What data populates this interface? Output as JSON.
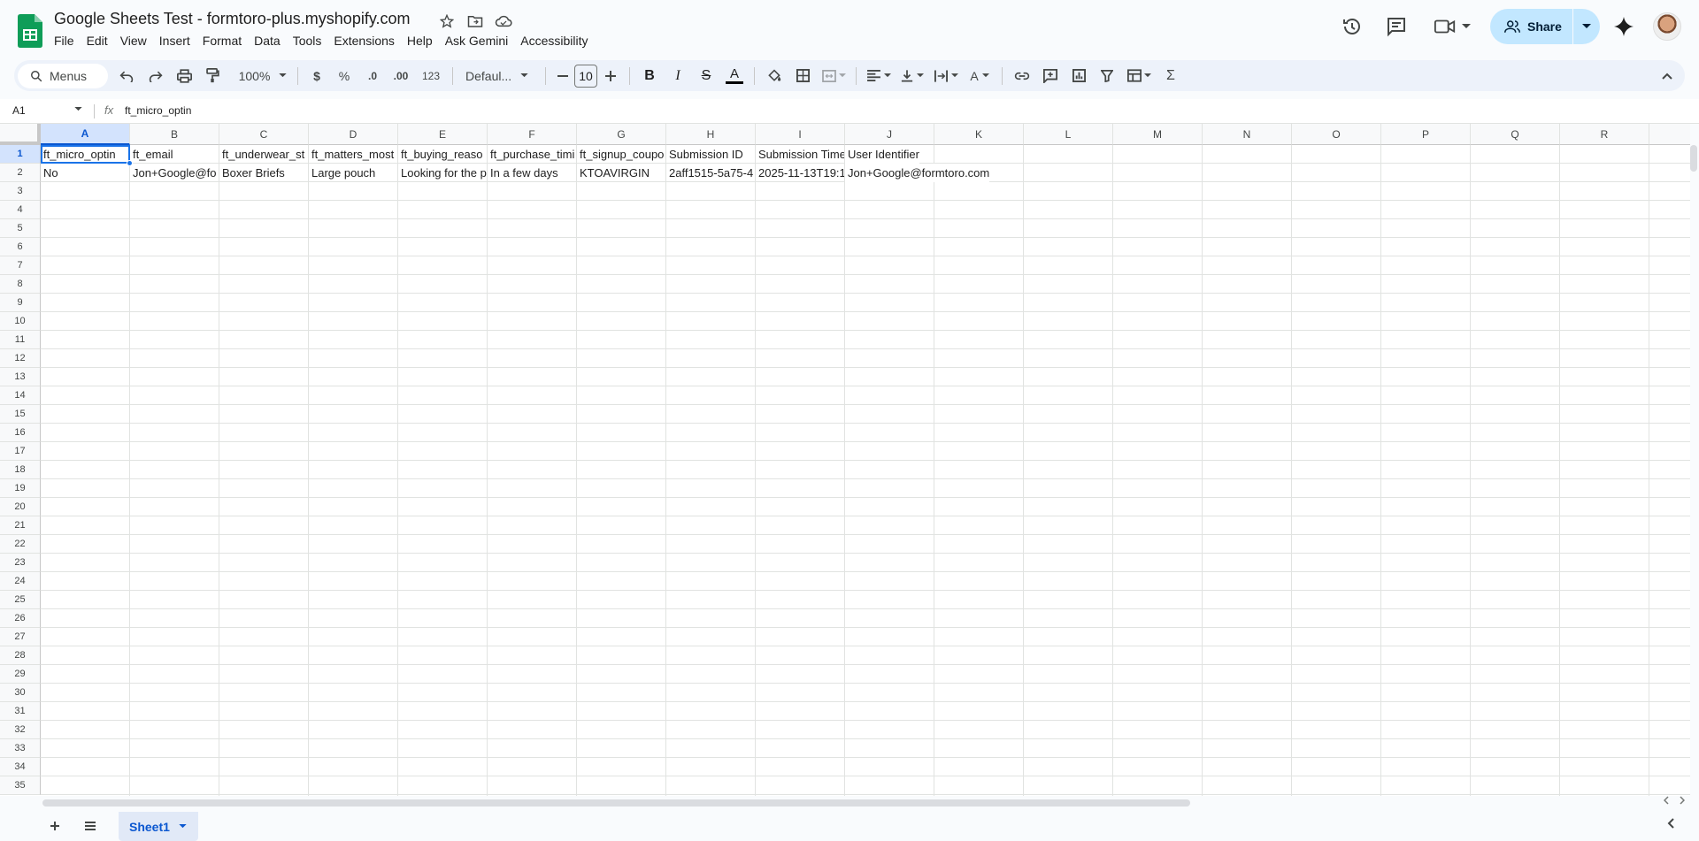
{
  "doc": {
    "title": "Google Sheets Test - formtoro-plus.myshopify.com"
  },
  "menu": [
    "File",
    "Edit",
    "View",
    "Insert",
    "Format",
    "Data",
    "Tools",
    "Extensions",
    "Help",
    "Ask Gemini",
    "Accessibility"
  ],
  "header_actions": {
    "share_label": "Share"
  },
  "toolbar": {
    "search_label": "Menus",
    "zoom": "100%",
    "currency": "$",
    "percent": "%",
    "dec_decrease": ".0",
    "dec_increase": ".00",
    "number_format": "123",
    "font": "Defaul...",
    "font_size": "10"
  },
  "formula_bar": {
    "name_box": "A1",
    "fx": "fx",
    "content": "ft_micro_optin"
  },
  "columns": [
    "A",
    "B",
    "C",
    "D",
    "E",
    "F",
    "G",
    "H",
    "I",
    "J",
    "K",
    "L",
    "M",
    "N",
    "O",
    "P",
    "Q",
    "R"
  ],
  "row_count": 35,
  "rows": [
    [
      "ft_micro_optin",
      "ft_email",
      "ft_underwear_st",
      "ft_matters_most",
      "ft_buying_reaso",
      "ft_purchase_timi",
      "ft_signup_coupo",
      "Submission ID",
      "Submission Time",
      "User Identifier"
    ],
    [
      "No",
      "Jon+Google@fo",
      "Boxer Briefs",
      "Large pouch",
      "Looking for the p",
      "In a few days",
      "KTOAVIRGIN",
      "2aff1515-5a75-4",
      "2025-11-13T19:1",
      "Jon+Google@formtoro.com"
    ]
  ],
  "sheet_tabs": [
    {
      "name": "Sheet1",
      "active": true
    }
  ],
  "colors": {
    "accent": "#0b57d0",
    "share_bg": "#c2e7ff",
    "selection": "#1a73e8",
    "sheets_green": "#0f9d58"
  }
}
